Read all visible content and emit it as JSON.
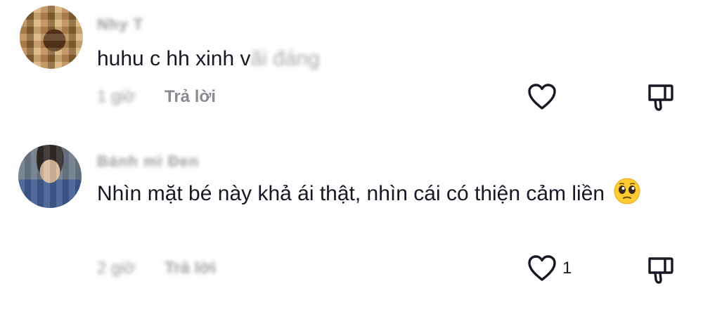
{
  "comments": [
    {
      "username": "Nhy T",
      "text_visible": "huhu c hh xinh v",
      "text_obscured": "ãi đáng",
      "time": "1 giờ",
      "reply_label": "Trả lời",
      "like_count": "",
      "avatar_icon": "avatar-pixelated"
    },
    {
      "username": "Bánh mì Đen",
      "text": "Nhìn mặt bé này khả ái thật, nhìn cái có thiện cảm liền",
      "emoji": "pleading-face-emoji",
      "time": "2 giờ",
      "reply_label": "Trả lời",
      "like_count": "1",
      "avatar_icon": "avatar-pixelated"
    }
  ],
  "icons": {
    "like": "heart-outline-icon",
    "dislike": "thumbs-down-outline-icon"
  },
  "colors": {
    "text": "#161823",
    "meta": "#8a8b91",
    "background": "#ffffff"
  }
}
